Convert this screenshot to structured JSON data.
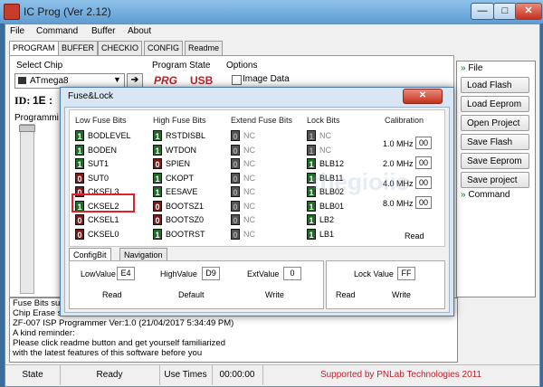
{
  "window": {
    "title": "IC Prog (Ver 2.12)",
    "min": "—",
    "max": "□",
    "close": "✕"
  },
  "menu": [
    "File",
    "Command",
    "Buffer",
    "About"
  ],
  "tabs": [
    "PROGRAM",
    "BUFFER",
    "CHECKIO",
    "CONFIG",
    "Readme"
  ],
  "select_chip": {
    "label": "Select Chip",
    "value": "ATmega8"
  },
  "id_line": {
    "label": "ID:",
    "value": "1E :"
  },
  "program_state": {
    "label": "Program State",
    "prg": "PRG",
    "usb": "USB"
  },
  "options": {
    "label": "Options",
    "image_data": "Image Data"
  },
  "programming_label": "Programmi",
  "side_menu": {
    "file_header": "File",
    "buttons": [
      "Load Flash",
      "Load Eeprom",
      "Open Project",
      "Save Flash",
      "Save Eeprom",
      "Save project"
    ],
    "command_header": "Command"
  },
  "dialog": {
    "title": "Fuse&Lock",
    "close": "✕",
    "headers": {
      "low": "Low Fuse Bits",
      "high": "High Fuse Bits",
      "ext": "Extend Fuse Bits",
      "lock": "Lock Bits",
      "cal": "Calibration"
    },
    "low": [
      {
        "bit": "1",
        "name": "BODLEVEL",
        "state": "on"
      },
      {
        "bit": "1",
        "name": "BODEN",
        "state": "on"
      },
      {
        "bit": "1",
        "name": "SUT1",
        "state": "on"
      },
      {
        "bit": "0",
        "name": "SUT0",
        "state": "off"
      },
      {
        "bit": "0",
        "name": "CKSEL3",
        "state": "off"
      },
      {
        "bit": "1",
        "name": "CKSEL2",
        "state": "on"
      },
      {
        "bit": "0",
        "name": "CKSEL1",
        "state": "off"
      },
      {
        "bit": "0",
        "name": "CKSEL0",
        "state": "off"
      }
    ],
    "high": [
      {
        "bit": "1",
        "name": "RSTDISBL",
        "state": "on"
      },
      {
        "bit": "1",
        "name": "WTDON",
        "state": "on"
      },
      {
        "bit": "0",
        "name": "SPIEN",
        "state": "off"
      },
      {
        "bit": "1",
        "name": "CKOPT",
        "state": "on"
      },
      {
        "bit": "1",
        "name": "EESAVE",
        "state": "on"
      },
      {
        "bit": "0",
        "name": "BOOTSZ1",
        "state": "off"
      },
      {
        "bit": "0",
        "name": "BOOTSZ0",
        "state": "off"
      },
      {
        "bit": "1",
        "name": "BOOTRST",
        "state": "on"
      }
    ],
    "ext": [
      {
        "bit": "0",
        "name": "NC"
      },
      {
        "bit": "0",
        "name": "NC"
      },
      {
        "bit": "0",
        "name": "NC"
      },
      {
        "bit": "0",
        "name": "NC"
      },
      {
        "bit": "0",
        "name": "NC"
      },
      {
        "bit": "0",
        "name": "NC"
      },
      {
        "bit": "0",
        "name": "NC"
      },
      {
        "bit": "0",
        "name": "NC"
      }
    ],
    "lock": [
      {
        "bit": "1",
        "name": "NC",
        "state": "blank"
      },
      {
        "bit": "1",
        "name": "NC",
        "state": "blank"
      },
      {
        "bit": "1",
        "name": "BLB12",
        "state": "on"
      },
      {
        "bit": "1",
        "name": "BLB11",
        "state": "on"
      },
      {
        "bit": "1",
        "name": "BLB02",
        "state": "on"
      },
      {
        "bit": "1",
        "name": "BLB01",
        "state": "on"
      },
      {
        "bit": "1",
        "name": "LB2",
        "state": "on"
      },
      {
        "bit": "1",
        "name": "LB1",
        "state": "on"
      }
    ],
    "calibration": [
      {
        "label": "1.0 MHz",
        "value": "00"
      },
      {
        "label": "2.0 MHz",
        "value": "00"
      },
      {
        "label": "4.0 MHz",
        "value": "00"
      },
      {
        "label": "8.0 MHz",
        "value": "00"
      }
    ],
    "cal_read": "Read",
    "bottom_tabs": [
      "ConfigBit",
      "Navigation"
    ],
    "low_value": {
      "label": "LowValue",
      "value": "E4"
    },
    "high_value": {
      "label": "HighValue",
      "value": "D9"
    },
    "ext_value": {
      "label": "ExtValue",
      "value": "0"
    },
    "lock_value": {
      "label": "Lock Value",
      "value": "FF"
    },
    "buttons": {
      "read": "Read",
      "default": "Default",
      "write": "Write",
      "lock_read": "Read",
      "lock_write": "Write"
    },
    "watermark": "thegioiic"
  },
  "log": [
    "Fuse Bits su",
    "Chip Erase s",
    "ZF-007 ISP Programmer Ver:1.0 (21/04/2017 5:34:49 PM)",
    "A kind reminder:",
    "Please click readme button and get yourself familiarized",
    "with the latest features of this software before you"
  ],
  "status": {
    "state_label": "State",
    "state_value": "Ready",
    "use_times_label": "Use Times",
    "use_times_value": "00:00:00",
    "support": "Supported by PNLab Technologies 2011"
  },
  "colors": {
    "titlebar": "#6aa6d8",
    "bit_on": "#1f6e27",
    "bit_off": "#7a1a1a",
    "highlight": "#e0202a",
    "support_text": "#c0202a"
  }
}
